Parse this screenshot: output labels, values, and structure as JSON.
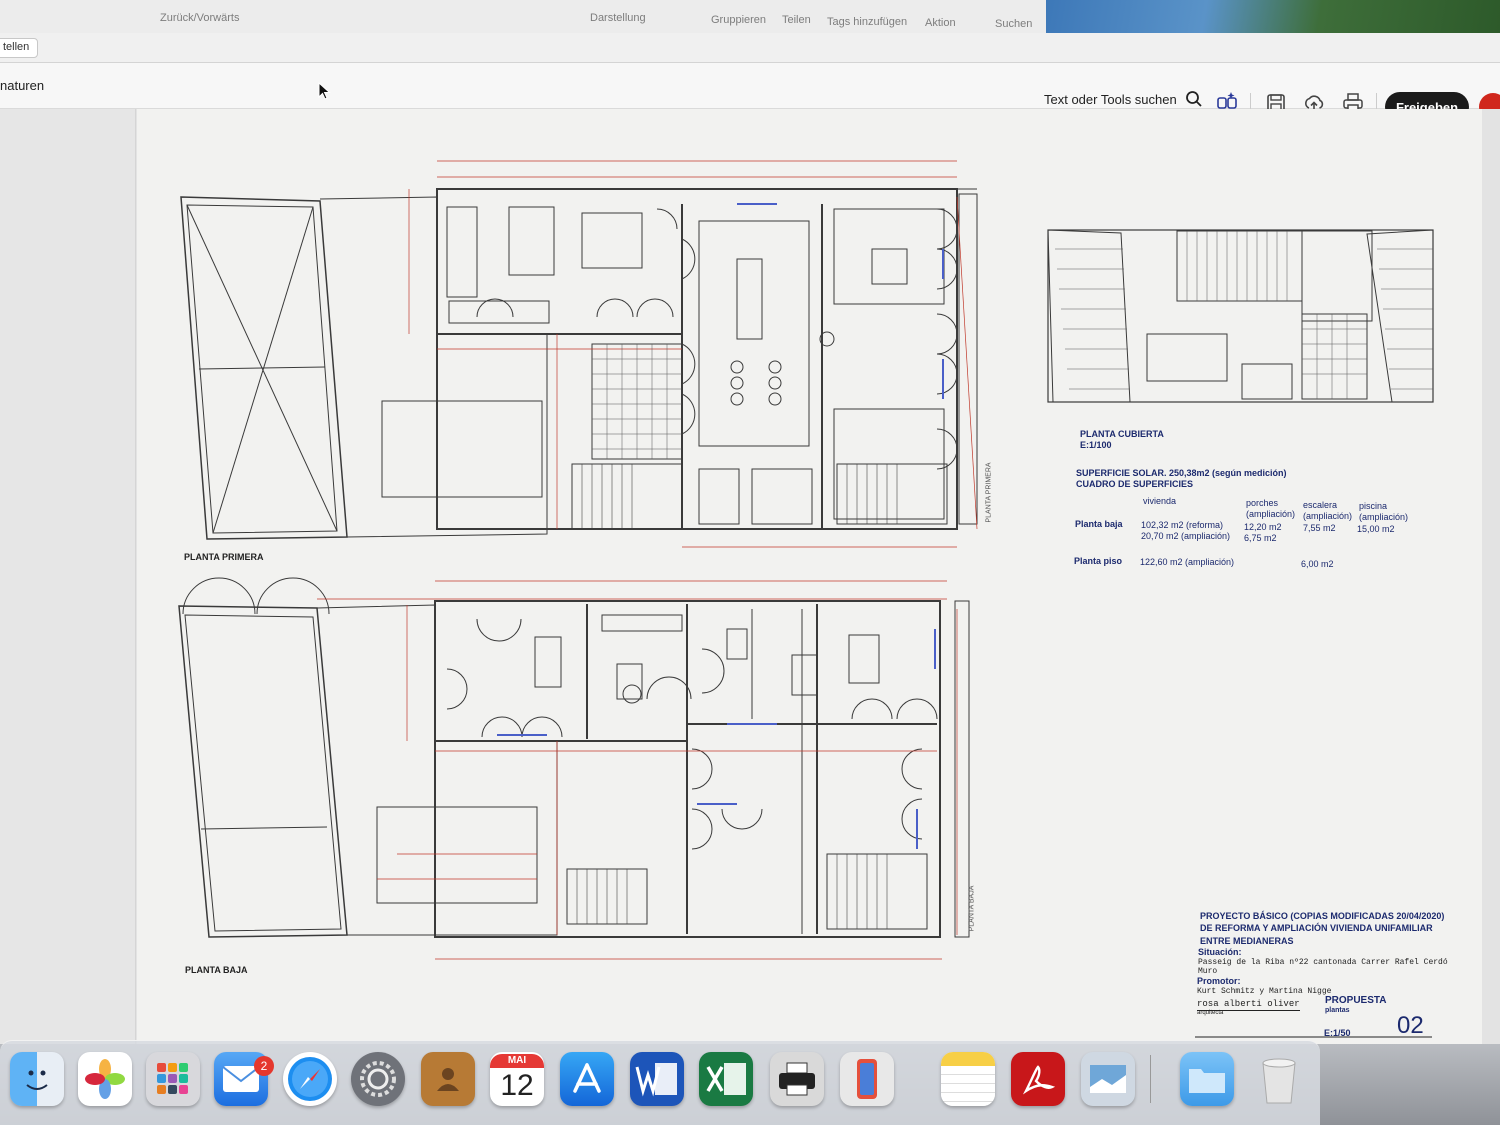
{
  "finder": {
    "back_forward": "Zurück/Vorwärts",
    "toolbar_items": [
      "Darstellung",
      "Gruppieren",
      "Teilen",
      "Tags hinzufügen",
      "Aktion",
      "Suchen"
    ]
  },
  "secondary": {
    "create_button": "tellen"
  },
  "acrobat": {
    "tab_label": "naturen",
    "search_tools": "Text oder Tools suchen",
    "share_button": "Freigeben",
    "icons": [
      "search-icon",
      "ai-assistant-icon",
      "save-icon",
      "upload-icon",
      "print-icon",
      "comment-icon"
    ]
  },
  "document": {
    "plan_upper_title": "PLANTA PRIMERA",
    "plan_lower_title": "PLANTA BAJA",
    "side_label_upper": "PLANTA PRIMERA",
    "side_label_lower": "PLANTA BAJA",
    "roof_title": "PLANTA CUBIERTA",
    "roof_scale": "E:1/100",
    "surface_line": "SUPERFICIE SOLAR. 250,38m2 (según medición)",
    "table_title": "CUADRO DE SUPERFICIES",
    "table_headers": [
      "vivienda",
      "porches (ampliación)",
      "escalera (ampliación)",
      "piscina (ampliación)"
    ],
    "row_baja_label": "Planta baja",
    "row_baja_vivienda_1": "102,32 m2 (reforma)",
    "row_baja_vivienda_2": "20,70 m2  (ampliación)",
    "row_baja_porches_1": "12,20 m2",
    "row_baja_porches_2": "6,75 m2",
    "row_baja_escalera": "7,55 m2",
    "row_baja_piscina": "15,00 m2",
    "row_piso_label": "Planta piso",
    "row_piso_vivienda": "122,60 m2 (ampliación)",
    "row_piso_escalera": "6,00 m2",
    "titleblock": {
      "line1": "PROYECTO BÁSICO (COPIAS MODIFICADAS 20/04/2020)",
      "line2": "DE REFORMA Y AMPLIACIÓN VIVIENDA UNIFAMILIAR",
      "line3": "ENTRE MEDIANERAS",
      "situacion_label": "Situación:",
      "situacion_1": "Passeig de la Riba nº22 cantonada Carrer Rafel Cerdó",
      "situacion_2": "Muro",
      "promotor_label": "Promotor:",
      "promotor": "Kurt Schmitz y Martina Nigge",
      "architect": "rosa alberti oliver",
      "architect_role": "arquitecta",
      "proposal": "PROPUESTA",
      "proposal_sub": "plantas",
      "scale": "E:1/50",
      "sheet": "02"
    }
  },
  "dock": {
    "calendar_month": "MAI",
    "calendar_day": "12",
    "mail_badge": "2",
    "apps": [
      "finder-icon",
      "photos-icon",
      "launchpad-icon",
      "mail-icon",
      "safari-icon",
      "system-settings-icon",
      "contacts-icon",
      "calendar-icon",
      "app-store-icon",
      "word-icon",
      "excel-icon",
      "printer-icon",
      "iphone-mirroring-icon",
      "notes-icon",
      "acrobat-icon",
      "preview-icon",
      "downloads-folder-icon",
      "trash-icon"
    ]
  }
}
